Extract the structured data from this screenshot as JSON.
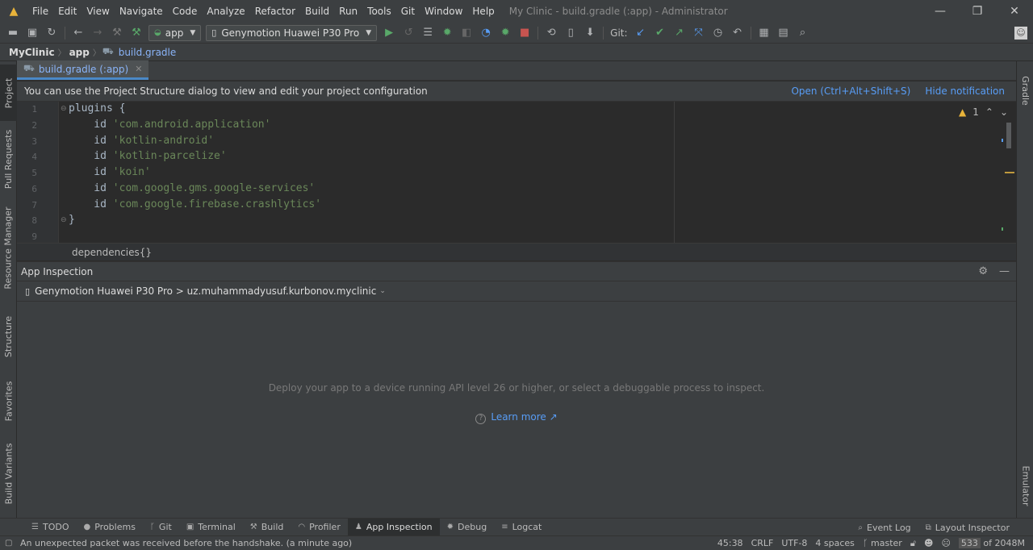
{
  "menubar": {
    "items": [
      "File",
      "Edit",
      "View",
      "Navigate",
      "Code",
      "Analyze",
      "Refactor",
      "Build",
      "Run",
      "Tools",
      "Git",
      "Window",
      "Help"
    ],
    "title": "My Clinic - build.gradle (:app) - Administrator",
    "window_controls": [
      "—",
      "❐",
      "✕"
    ]
  },
  "toolbar": {
    "config_label": "app",
    "device_label": "Genymotion Huawei P30 Pro",
    "git_label": "Git:"
  },
  "navbar": {
    "crumbs": [
      "MyClinic",
      "app",
      "build.gradle"
    ]
  },
  "left_strip": [
    "Project",
    "Pull Requests",
    "Resource Manager",
    "Structure",
    "Favorites",
    "Build Variants"
  ],
  "right_strip": [
    "Gradle",
    "Emulator"
  ],
  "editor": {
    "tab_label": "build.gradle (:app)",
    "notice": "You can use the Project Structure dialog to view and edit your project configuration",
    "notice_open": "Open (Ctrl+Alt+Shift+S)",
    "notice_hide": "Hide notification",
    "warning_count": "1",
    "line_numbers": [
      "1",
      "2",
      "3",
      "4",
      "5",
      "6",
      "7",
      "8",
      "9"
    ],
    "lines": [
      {
        "kw": "plugins {",
        "str": ""
      },
      {
        "kw": "    id ",
        "str": "'com.android.application'"
      },
      {
        "kw": "    id ",
        "str": "'kotlin-android'"
      },
      {
        "kw": "    id ",
        "str": "'kotlin-parcelize'"
      },
      {
        "kw": "    id ",
        "str": "'koin'"
      },
      {
        "kw": "    id ",
        "str": "'com.google.gms.google-services'"
      },
      {
        "kw": "    id ",
        "str": "'com.google.firebase.crashlytics'"
      },
      {
        "kw": "}",
        "str": ""
      },
      {
        "kw": "",
        "str": ""
      }
    ],
    "breadcrumb": "dependencies{}"
  },
  "inspection": {
    "title": "App Inspection",
    "process": "Genymotion Huawei P30 Pro > uz.muhammadyusuf.kurbonov.myclinic",
    "empty_message": "Deploy your app to a device running API level 26 or higher, or select a debuggable process to inspect.",
    "learn_more": "Learn more ↗"
  },
  "bottom_tabs": [
    "TODO",
    "Problems",
    "Git",
    "Terminal",
    "Build",
    "Profiler",
    "App Inspection",
    "Debug",
    "Logcat"
  ],
  "bottom_right_tabs": [
    "Event Log",
    "Layout Inspector"
  ],
  "status": {
    "message": "An unexpected packet was received before the handshake. (a minute ago)",
    "position": "45:38",
    "line_sep": "CRLF",
    "encoding": "UTF-8",
    "indent": "4 spaces",
    "branch": "master",
    "memory_used": "533",
    "memory_total": "of 2048M"
  },
  "colors": {
    "accent": "#589df6",
    "warning": "#e8b33a",
    "string": "#6a8759",
    "run_green": "#59a869",
    "stop_red": "#c75450"
  }
}
